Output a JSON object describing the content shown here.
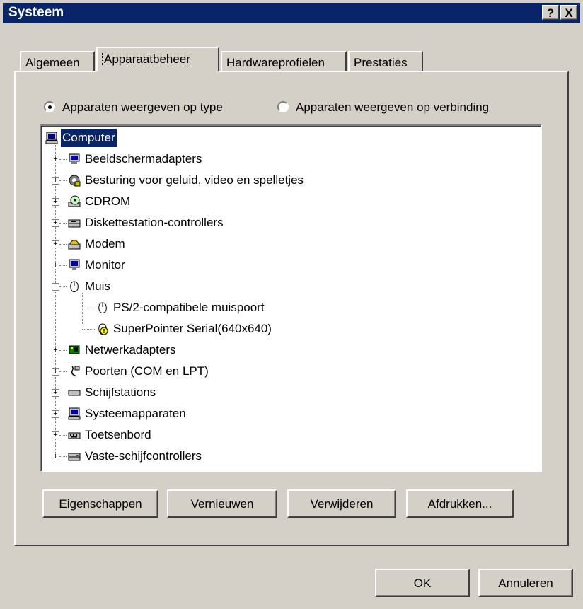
{
  "window": {
    "title": "Systeem",
    "help_label": "?",
    "close_label": "X"
  },
  "tabs": [
    {
      "label": "Algemeen"
    },
    {
      "label": "Apparaatbeheer"
    },
    {
      "label": "Hardwareprofielen"
    },
    {
      "label": "Prestaties"
    }
  ],
  "view_options": {
    "by_type_label": "Apparaten weergeven op type",
    "by_connection_label": "Apparaten weergeven op verbinding",
    "selected": "by_type"
  },
  "tree": {
    "root": "Computer",
    "items": [
      {
        "label": "Beeldschermadapters",
        "icon": "display-adapter-icon",
        "expanded": false
      },
      {
        "label": "Besturing voor geluid, video en spelletjes",
        "icon": "sound-video-icon",
        "expanded": false
      },
      {
        "label": "CDROM",
        "icon": "cdrom-icon",
        "expanded": false
      },
      {
        "label": "Diskettestation-controllers",
        "icon": "floppy-controller-icon",
        "expanded": false
      },
      {
        "label": "Modem",
        "icon": "modem-icon",
        "expanded": false
      },
      {
        "label": "Monitor",
        "icon": "monitor-icon",
        "expanded": false
      },
      {
        "label": "Muis",
        "icon": "mouse-icon",
        "expanded": true
      },
      {
        "label": "Netwerkadapters",
        "icon": "network-adapter-icon",
        "expanded": false
      },
      {
        "label": "Poorten (COM en LPT)",
        "icon": "ports-icon",
        "expanded": false
      },
      {
        "label": "Schijfstations",
        "icon": "disk-drive-icon",
        "expanded": false
      },
      {
        "label": "Systeemapparaten",
        "icon": "system-devices-icon",
        "expanded": false
      },
      {
        "label": "Toetsenbord",
        "icon": "keyboard-icon",
        "expanded": false
      },
      {
        "label": "Vaste-schijfcontrollers",
        "icon": "hdd-controller-icon",
        "expanded": false
      }
    ],
    "mouse_children": [
      {
        "label": "PS/2-compatibele muispoort",
        "icon": "mouse-icon",
        "warning": false
      },
      {
        "label": "SuperPointer Serial(640x640)",
        "icon": "mouse-warning-icon",
        "warning": true
      }
    ]
  },
  "buttons": {
    "properties": "Eigenschappen",
    "refresh": "Vernieuwen",
    "remove": "Verwijderen",
    "print": "Afdrukken...",
    "ok": "OK",
    "cancel": "Annuleren"
  },
  "colors": {
    "titlebar": "#0a246a",
    "face": "#d4d0c8",
    "selection": "#0a246a"
  }
}
